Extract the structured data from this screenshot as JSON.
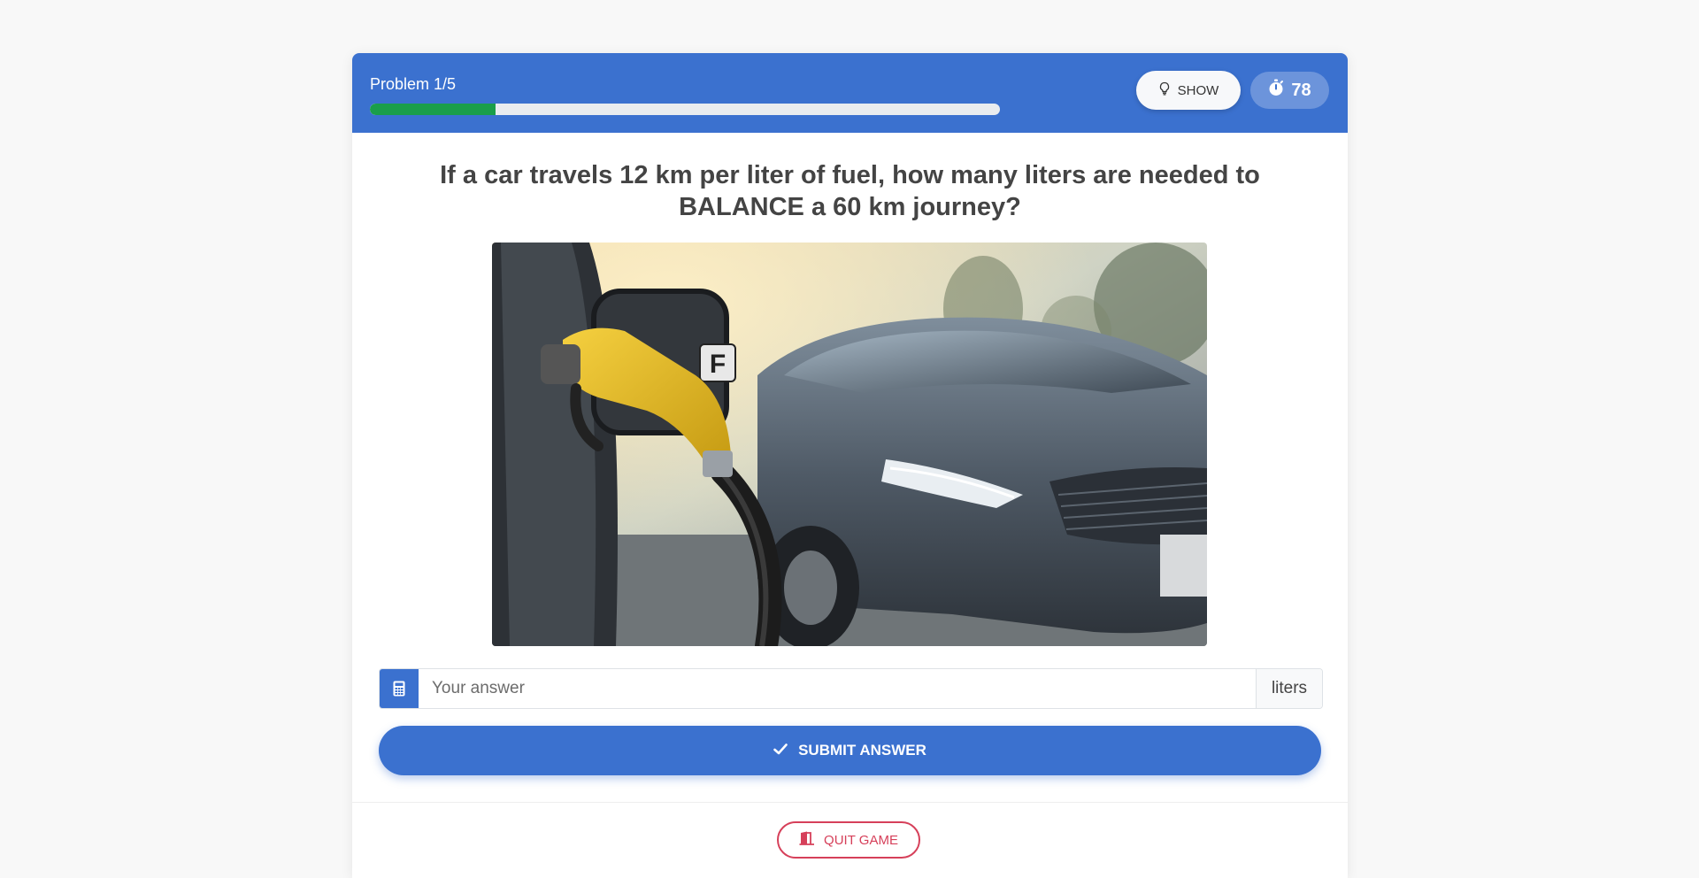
{
  "header": {
    "problem_label": "Problem 1/5",
    "progress_fraction": 0.2,
    "progress_color": "#1a9e4a",
    "background_color": "#3b71cf",
    "show_button": {
      "label": "SHOW",
      "icon": "lightbulb-icon"
    },
    "timer": {
      "value": "78",
      "icon": "stopwatch-icon"
    }
  },
  "question": {
    "text": "If a car travels 12 km per liter of fuel, how many liters are needed to BALANCE a 60 km journey?",
    "image": {
      "alt": "Gray car being refueled with a yellow fuel nozzle",
      "fuel_cap_letter": "F"
    }
  },
  "answer": {
    "placeholder": "Your answer",
    "value": "",
    "unit": "liters",
    "addon_icon": "calculator-icon"
  },
  "submit_button": {
    "label": "SUBMIT ANSWER",
    "icon": "check-icon"
  },
  "quit_button": {
    "label": "QUIT GAME",
    "icon": "exit-door-icon",
    "color": "#d6405a"
  }
}
